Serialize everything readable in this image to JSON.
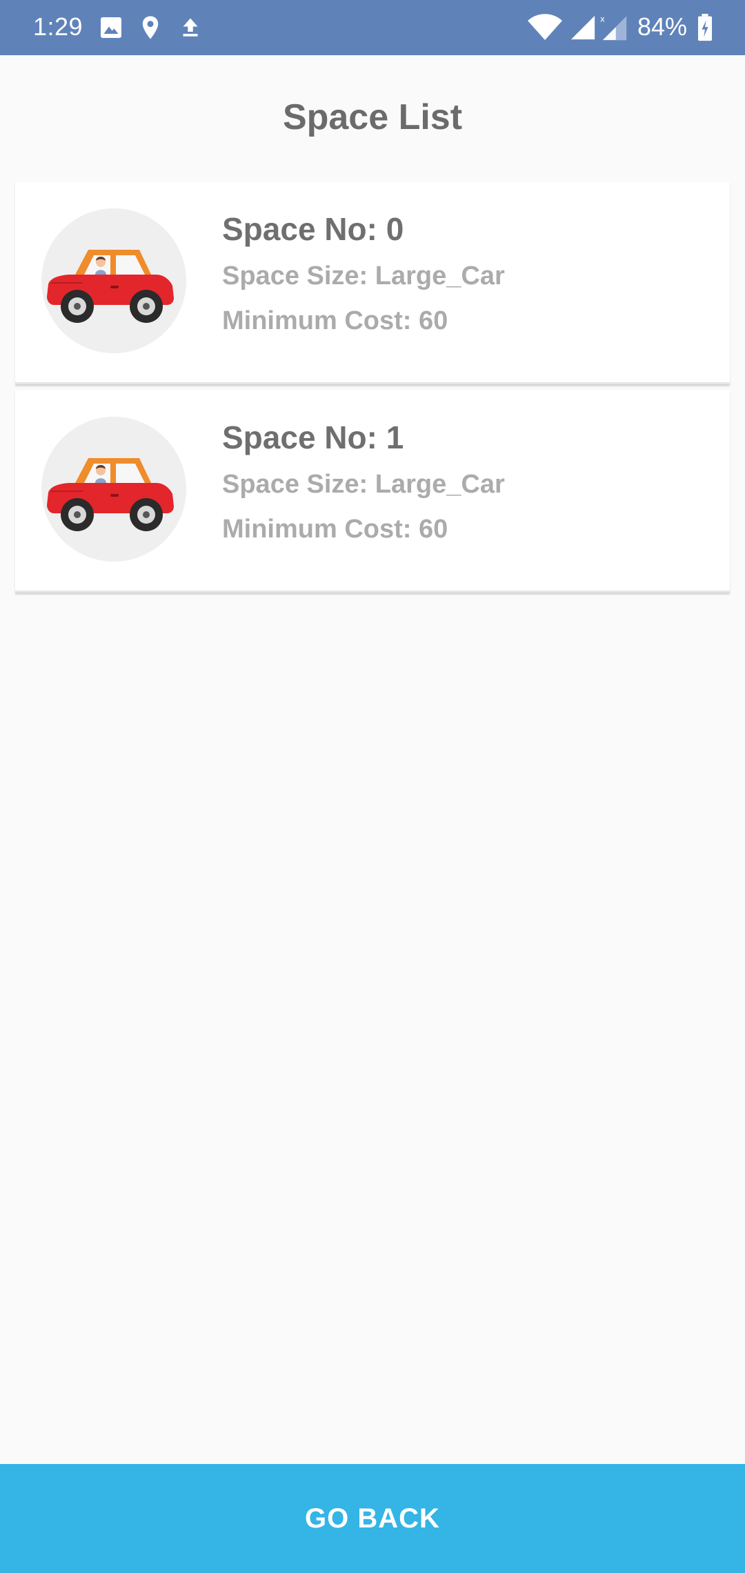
{
  "status_bar": {
    "time": "1:29",
    "battery": "84%",
    "left_icons": [
      "image-icon",
      "location-pin-icon",
      "upload-icon"
    ],
    "right_icons": [
      "wifi-icon",
      "signal-icon",
      "signal-no-data-icon",
      "battery-charging-icon"
    ],
    "background_color": "#5f82b9"
  },
  "page": {
    "title": "Space List"
  },
  "spaces": [
    {
      "number": "Space No: 0",
      "size": "Space Size: Large_Car",
      "cost": "Minimum Cost: 60",
      "icon": "car-icon"
    },
    {
      "number": "Space No: 1",
      "size": "Space Size: Large_Car",
      "cost": "Minimum Cost: 60",
      "icon": "car-icon"
    }
  ],
  "footer": {
    "button_label": "GO BACK",
    "button_color": "#34b5e5"
  }
}
